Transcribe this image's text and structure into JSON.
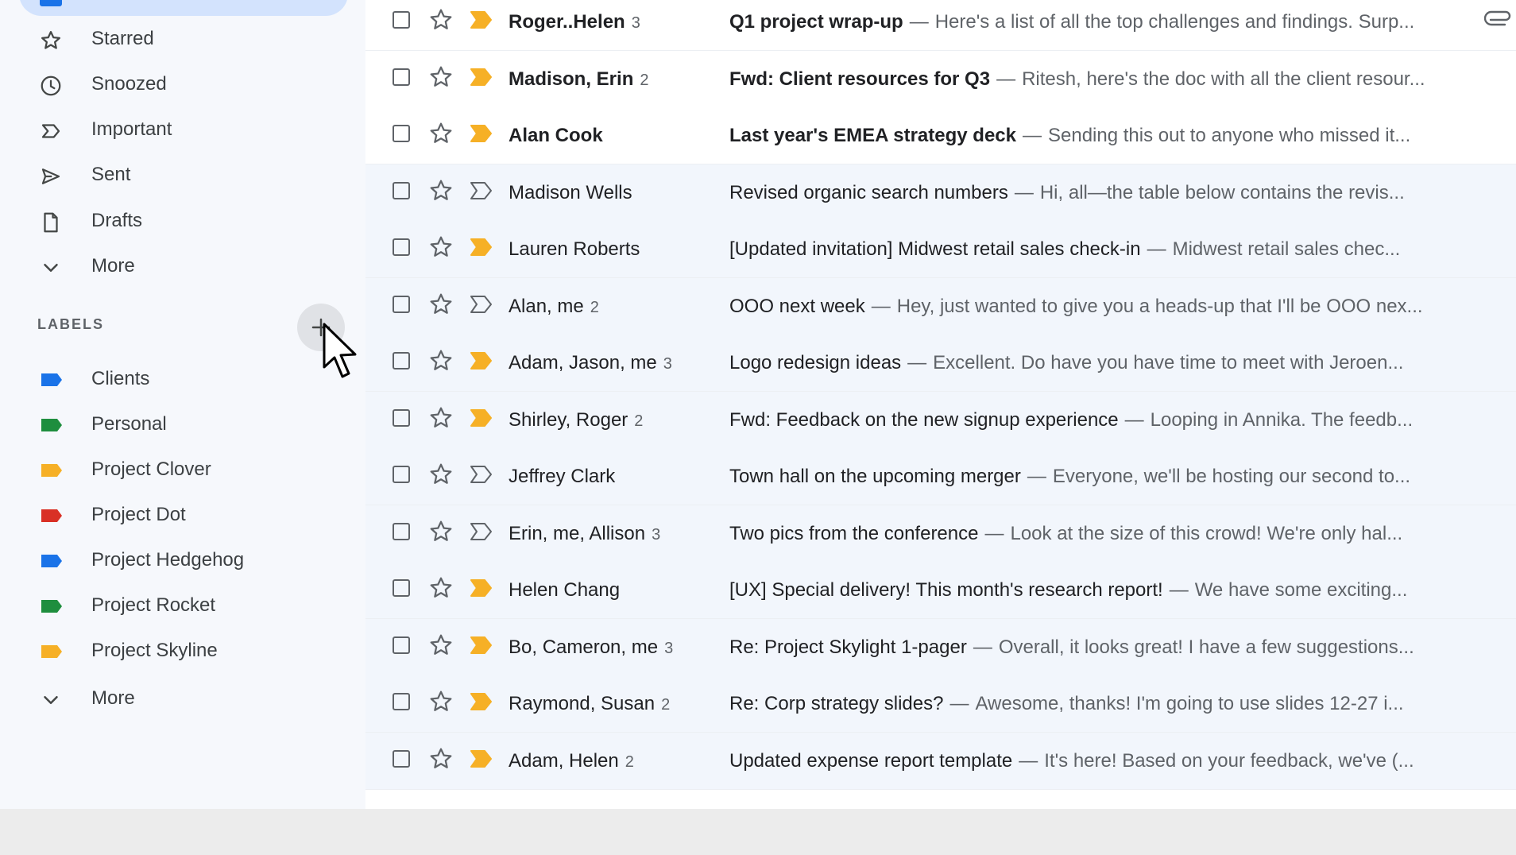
{
  "sidebar": {
    "nav": [
      {
        "label": "Starred",
        "icon": "star-icon"
      },
      {
        "label": "Snoozed",
        "icon": "clock-icon"
      },
      {
        "label": "Important",
        "icon": "important-icon"
      },
      {
        "label": "Sent",
        "icon": "send-icon"
      },
      {
        "label": "Drafts",
        "icon": "draft-icon"
      },
      {
        "label": "More",
        "icon": "chevron-down-icon"
      }
    ],
    "labels_title": "LABELS",
    "labels": [
      {
        "label": "Clients",
        "color": "#1a73e8"
      },
      {
        "label": "Personal",
        "color": "#1e8e3e"
      },
      {
        "label": "Project Clover",
        "color": "#f6b026"
      },
      {
        "label": "Project Dot",
        "color": "#d93025"
      },
      {
        "label": "Project Hedgehog",
        "color": "#1a73e8"
      },
      {
        "label": "Project Rocket",
        "color": "#1e8e3e"
      },
      {
        "label": "Project Skyline",
        "color": "#f6b026"
      }
    ],
    "labels_more": "More",
    "add_label_symbol": "+"
  },
  "colors": {
    "important": "#f6b026",
    "important_outline": "#5f6368"
  },
  "emails": [
    {
      "sender": "Roger..Helen",
      "count": "3",
      "subject": "Q1 project wrap-up",
      "snippet": "Here's a list of all the top challenges and findings. Surp...",
      "unread": true,
      "important": true,
      "attachment": true
    },
    {
      "sender": "Madison, Erin",
      "count": "2",
      "subject": "Fwd: Client resources for Q3",
      "snippet": "Ritesh, here's the doc with all the client resour...",
      "unread": true,
      "important": true,
      "attachment": false
    },
    {
      "sender": "Alan Cook",
      "count": "",
      "subject": "Last year's EMEA strategy deck",
      "snippet": "Sending this out to anyone who missed it...",
      "unread": true,
      "important": true,
      "attachment": false
    },
    {
      "sender": "Madison Wells",
      "count": "",
      "subject": "Revised organic search numbers",
      "snippet": "Hi, all—the table below contains the revis...",
      "unread": false,
      "important": false,
      "attachment": false
    },
    {
      "sender": "Lauren Roberts",
      "count": "",
      "subject": "[Updated invitation] Midwest retail sales check-in",
      "snippet": "Midwest retail sales chec...",
      "unread": false,
      "important": true,
      "attachment": false
    },
    {
      "sender": "Alan, me",
      "count": "2",
      "subject": "OOO next week",
      "snippet": "Hey, just wanted to give you a heads-up that I'll be OOO nex...",
      "unread": false,
      "important": false,
      "attachment": false
    },
    {
      "sender": "Adam, Jason, me",
      "count": "3",
      "subject": "Logo redesign ideas",
      "snippet": "Excellent. Do have you have time to meet with Jeroen...",
      "unread": false,
      "important": true,
      "attachment": false
    },
    {
      "sender": "Shirley, Roger",
      "count": "2",
      "subject": "Fwd: Feedback on the new signup experience",
      "snippet": "Looping in Annika. The feedb...",
      "unread": false,
      "important": true,
      "attachment": false
    },
    {
      "sender": "Jeffrey Clark",
      "count": "",
      "subject": "Town hall on the upcoming merger",
      "snippet": "Everyone, we'll be hosting our second to...",
      "unread": false,
      "important": false,
      "attachment": false
    },
    {
      "sender": "Erin, me, Allison",
      "count": "3",
      "subject": "Two pics from the conference",
      "snippet": "Look at the size of this crowd! We're only hal...",
      "unread": false,
      "important": false,
      "attachment": false
    },
    {
      "sender": "Helen Chang",
      "count": "",
      "subject": "[UX] Special delivery! This month's research report!",
      "snippet": "We have some exciting...",
      "unread": false,
      "important": true,
      "attachment": false
    },
    {
      "sender": "Bo, Cameron, me",
      "count": "3",
      "subject": "Re: Project Skylight 1-pager",
      "snippet": "Overall, it looks great! I have a few suggestions...",
      "unread": false,
      "important": true,
      "attachment": false
    },
    {
      "sender": "Raymond, Susan",
      "count": "2",
      "subject": "Re: Corp strategy slides?",
      "snippet": "Awesome, thanks! I'm going to use slides 12-27 i...",
      "unread": false,
      "important": true,
      "attachment": false
    },
    {
      "sender": "Adam, Helen",
      "count": "2",
      "subject": "Updated expense report template",
      "snippet": "It's here! Based on your feedback, we've (...",
      "unread": false,
      "important": true,
      "attachment": false
    }
  ]
}
